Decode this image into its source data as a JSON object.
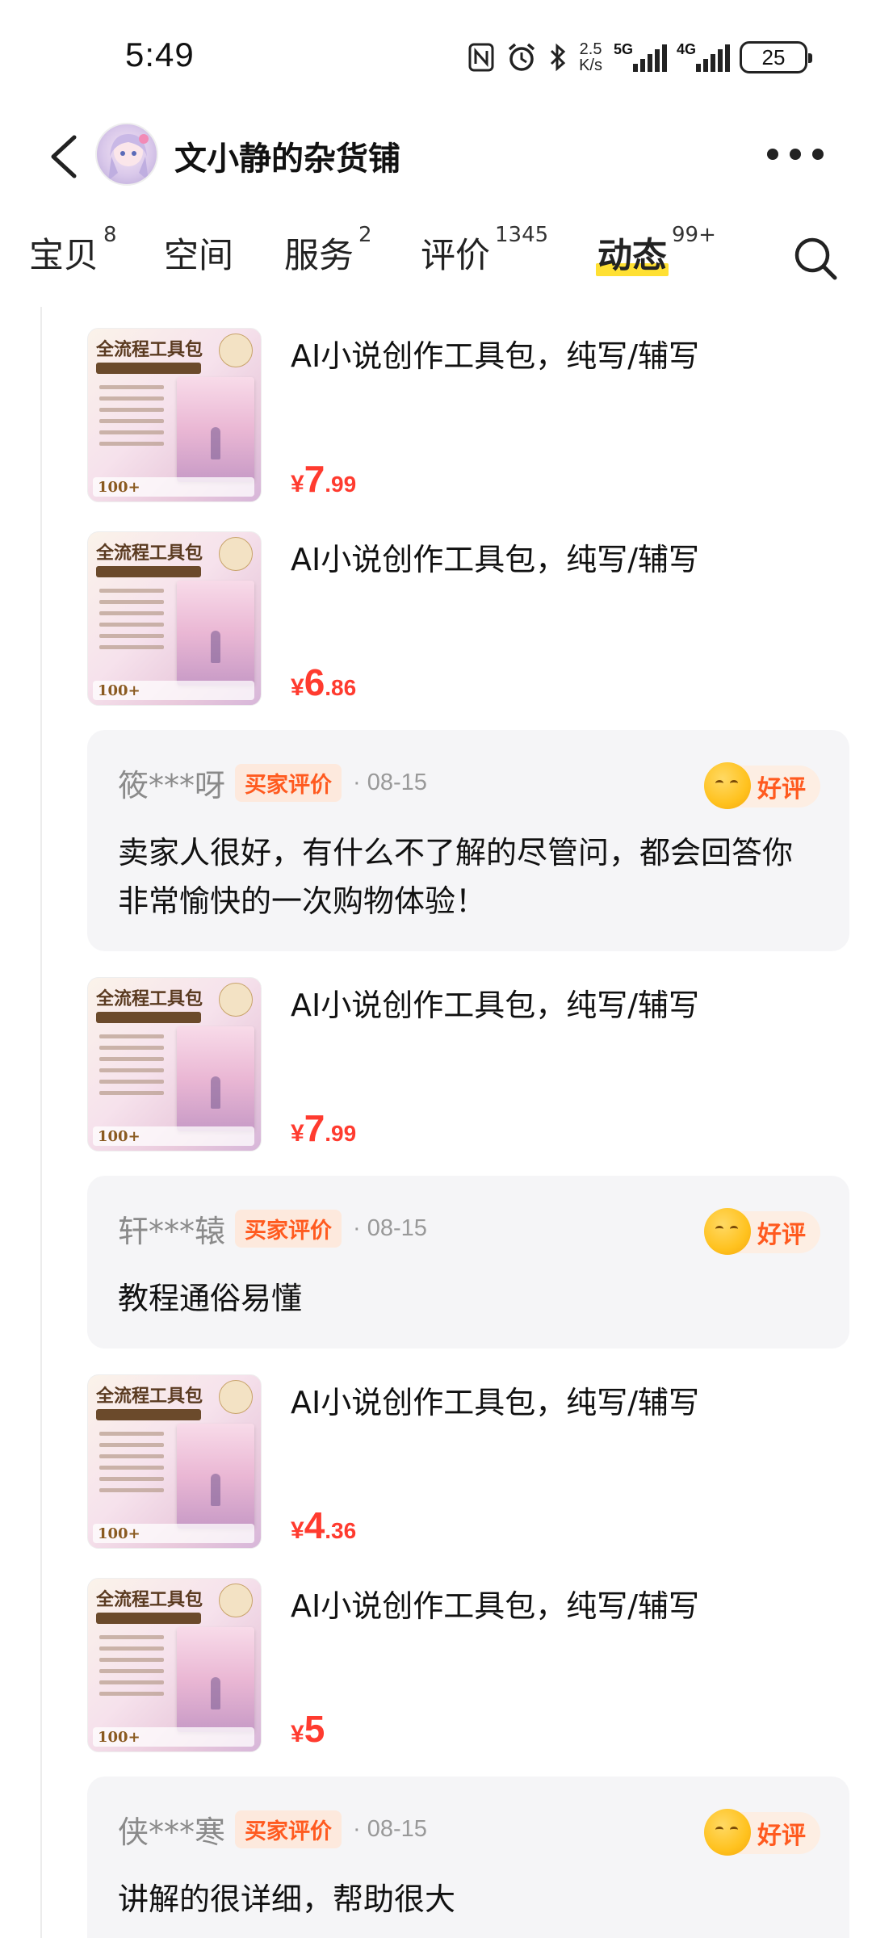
{
  "status_bar": {
    "time": "5:49",
    "net_speed_value": "2.5",
    "net_speed_unit": "K/s",
    "signal_1": "5G",
    "signal_2": "4G",
    "battery": "25",
    "icons": [
      "nfc-icon",
      "alarm-icon",
      "bluetooth-icon",
      "signal-5g-icon",
      "signal-4g-icon",
      "battery-icon"
    ]
  },
  "header": {
    "shop_name": "文小静的杂货铺"
  },
  "tabs": [
    {
      "label": "宝贝",
      "badge": "8"
    },
    {
      "label": "空间",
      "badge": ""
    },
    {
      "label": "服务",
      "badge": "2"
    },
    {
      "label": "评价",
      "badge": "1345"
    },
    {
      "label": "动态",
      "badge": "99+",
      "active": true
    }
  ],
  "colors": {
    "price": "#ff3b2f",
    "tag": "#ff5a1f",
    "tab_highlight": "#ffe033",
    "review_bg": "#f5f5f7"
  },
  "thumb": {
    "title": "全流程工具包",
    "footer": "100+"
  },
  "products": [
    {
      "title": "AI小说创作工具包，纯写/辅写",
      "currency": "¥",
      "price_int": "7",
      "price_dec": ".99"
    },
    {
      "title": "AI小说创作工具包，纯写/辅写",
      "currency": "¥",
      "price_int": "6",
      "price_dec": ".86"
    },
    {
      "title": "AI小说创作工具包，纯写/辅写",
      "currency": "¥",
      "price_int": "7",
      "price_dec": ".99"
    },
    {
      "title": "AI小说创作工具包，纯写/辅写",
      "currency": "¥",
      "price_int": "4",
      "price_dec": ".36"
    },
    {
      "title": "AI小说创作工具包，纯写/辅写",
      "currency": "¥",
      "price_int": "5",
      "price_dec": ""
    }
  ],
  "reviews": [
    {
      "user": "筱***呀",
      "tag": "买家评价",
      "date": "· 08-15",
      "rating": "好评",
      "text": "卖家人很好，有什么不了解的尽管问，都会回答你 非常愉快的一次购物体验！"
    },
    {
      "user": "轩***辕",
      "tag": "买家评价",
      "date": "· 08-15",
      "rating": "好评",
      "text": "教程通俗易懂"
    },
    {
      "user": "侠***寒",
      "tag": "买家评价",
      "date": "· 08-15",
      "rating": "好评",
      "text": "讲解的很详细，帮助很大"
    }
  ]
}
